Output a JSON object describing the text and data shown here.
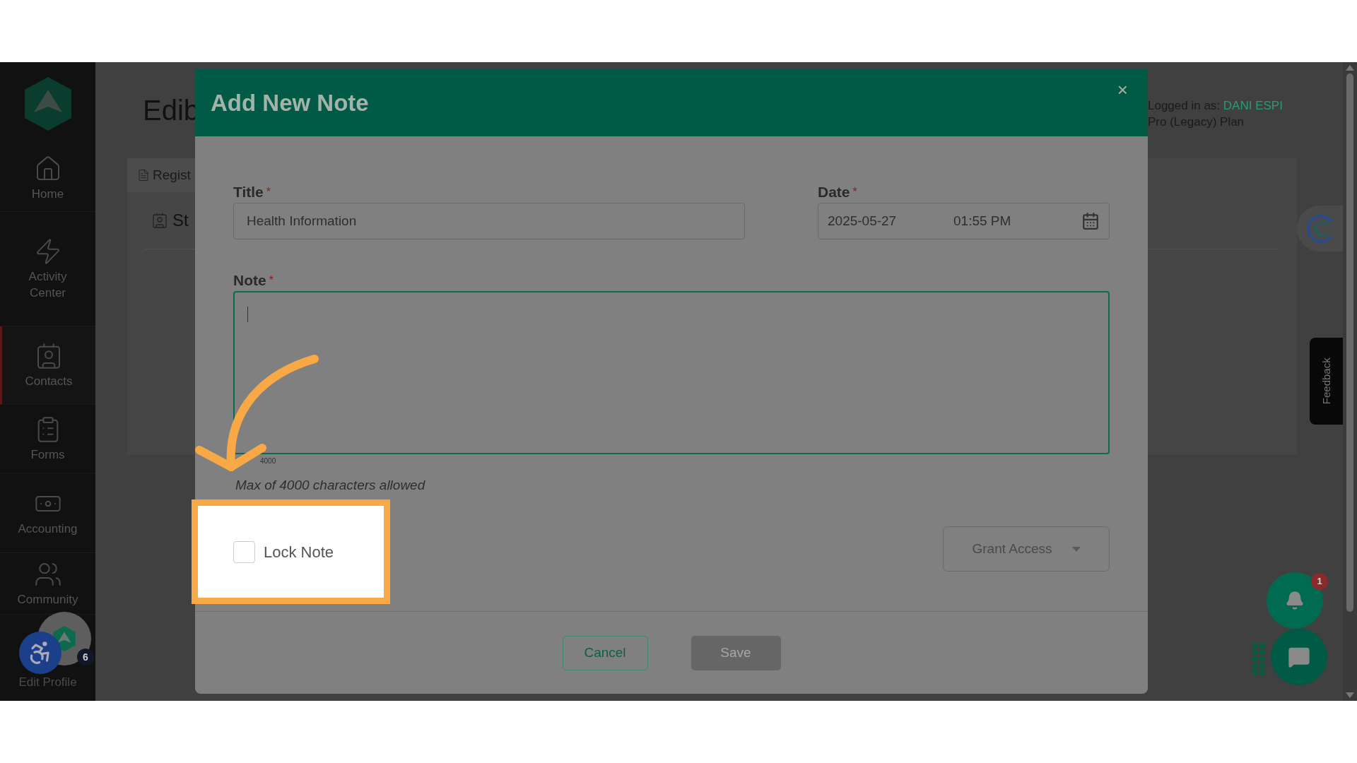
{
  "sidebar": {
    "items": [
      {
        "kind": "home",
        "label": "Home",
        "selected": false
      },
      {
        "kind": "activity",
        "label": "Activity Center",
        "selected": false
      },
      {
        "kind": "contacts",
        "label": "Contacts",
        "selected": true
      },
      {
        "kind": "forms",
        "label": "Forms",
        "selected": false
      },
      {
        "kind": "accounting",
        "label": "Accounting",
        "selected": false
      },
      {
        "kind": "community",
        "label": "Community",
        "selected": false
      },
      {
        "kind": "profile",
        "label": "Edit Profile",
        "selected": false
      }
    ],
    "profile_badge": "6"
  },
  "page": {
    "heading": "Edib",
    "tab": "Regist",
    "section": "St",
    "user_prefix": "Logged in as:",
    "user_name": "DANI ESPI",
    "plan": "Pro (Legacy) Plan"
  },
  "feedback": "Feedback",
  "notification_badge": "1",
  "modal": {
    "title": "Add New Note",
    "close": "×",
    "title_field": {
      "label": "Title",
      "required_mark": "*",
      "value": "Health Information"
    },
    "date_field": {
      "label": "Date",
      "required_mark": "*",
      "date": "2025-05-27",
      "time": "01:55 PM"
    },
    "note_field": {
      "label": "Note",
      "required_mark": "*",
      "counter": "4000",
      "hint": "Max of 4000 characters allowed"
    },
    "lock": {
      "label": "Lock Note",
      "checked": false
    },
    "grant_access": "Grant Access",
    "buttons": [
      {
        "kind": "secondary",
        "label": "Cancel",
        "disabled": false
      },
      {
        "kind": "primary",
        "label": "Save",
        "disabled": true
      }
    ]
  }
}
